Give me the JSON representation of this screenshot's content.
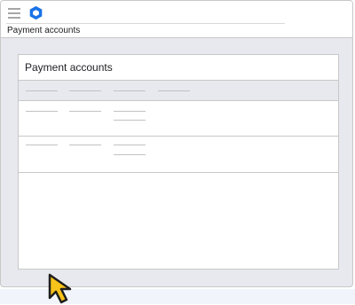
{
  "header": {
    "menu_icon": "hamburger-menu-icon",
    "logo_icon": "blue-hexagon-logo-icon",
    "breadcrumb": "Payment accounts"
  },
  "card": {
    "title": "Payment accounts",
    "table": {
      "header_cells": [
        "",
        "",
        "",
        ""
      ],
      "rows": [
        {
          "cells": [
            "",
            "",
            ""
          ]
        },
        {
          "cells": [
            "",
            "",
            ""
          ]
        }
      ]
    }
  },
  "cursor": {
    "icon": "mouse-pointer-cursor-icon",
    "color": "#f7c21a"
  },
  "colors": {
    "accent": "#1a73e8",
    "background": "#e8e9ee",
    "border": "#c8c8c8"
  }
}
